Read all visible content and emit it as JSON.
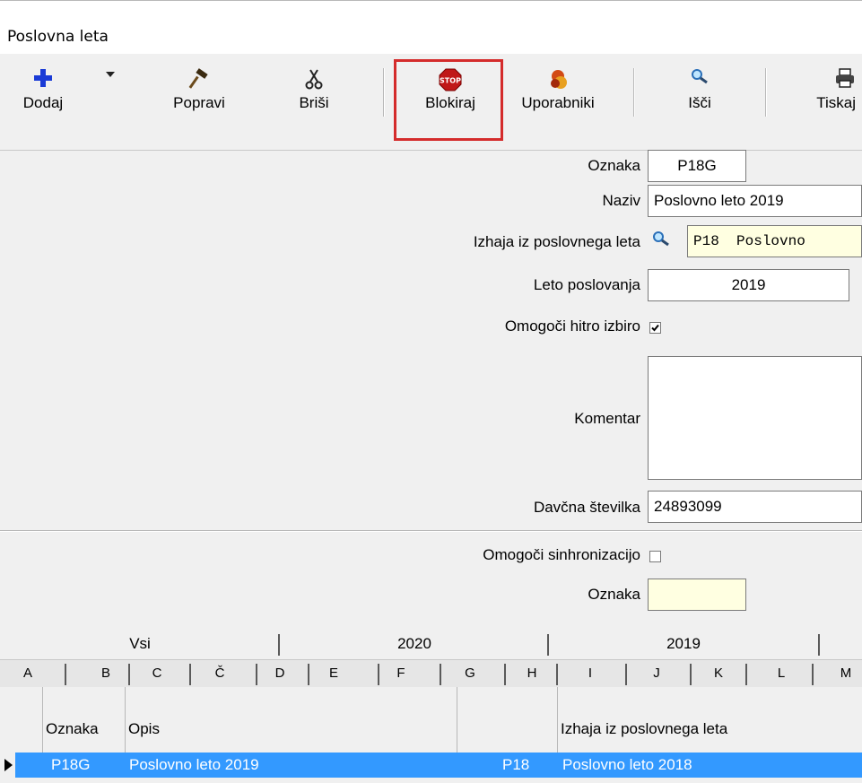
{
  "window": {
    "title": "Poslovna leta"
  },
  "toolbar": {
    "buttons": [
      {
        "label": "Dodaj",
        "icon": "plus-icon"
      },
      {
        "label": "Popravi",
        "icon": "hammer-icon"
      },
      {
        "label": "Briši",
        "icon": "scissors-icon"
      },
      {
        "label": "Blokiraj",
        "icon": "stop-sign-icon"
      },
      {
        "label": "Uporabniki",
        "icon": "users-icon"
      },
      {
        "label": "Išči",
        "icon": "magnifier-icon"
      },
      {
        "label": "Tiskaj",
        "icon": "printer-icon"
      }
    ],
    "dropdown_arrow": "▾"
  },
  "form": {
    "oznaka_label": "Oznaka",
    "oznaka_value": "P18G",
    "naziv_label": "Naziv",
    "naziv_value": "Poslovno leto 2019",
    "izhaja_label": "Izhaja iz poslovnega leta",
    "izhaja_value": "P18  Poslovno",
    "leto_label": "Leto poslovanja",
    "leto_value": "2019",
    "hitro_label": "Omogoči hitro izbiro",
    "hitro_checked": true,
    "komentar_label": "Komentar",
    "komentar_value": "",
    "davcna_label": "Davčna številka",
    "davcna_value": "24893099",
    "sinhro_label": "Omogoči sinhronizacijo",
    "sinhro_checked": false,
    "oznaka2_label": "Oznaka",
    "oznaka2_value": ""
  },
  "tabs": [
    "Vsi",
    "2020",
    "2019"
  ],
  "letters": [
    "A",
    "B",
    "C",
    "Č",
    "D",
    "E",
    "F",
    "G",
    "H",
    "I",
    "J",
    "K",
    "L",
    "M"
  ],
  "grid": {
    "headers": [
      "Oznaka",
      "Opis",
      "",
      "Izhaja iz poslovnega leta"
    ],
    "rows": [
      {
        "oznaka": "P18G",
        "opis": "Poslovno leto 2019",
        "izhaja_koda": "P18",
        "izhaja": "Poslovno leto 2018"
      }
    ]
  },
  "colors": {
    "selection": "#3399ff",
    "highlight": "#d42b2b",
    "yellow_field": "#ffffe1"
  }
}
